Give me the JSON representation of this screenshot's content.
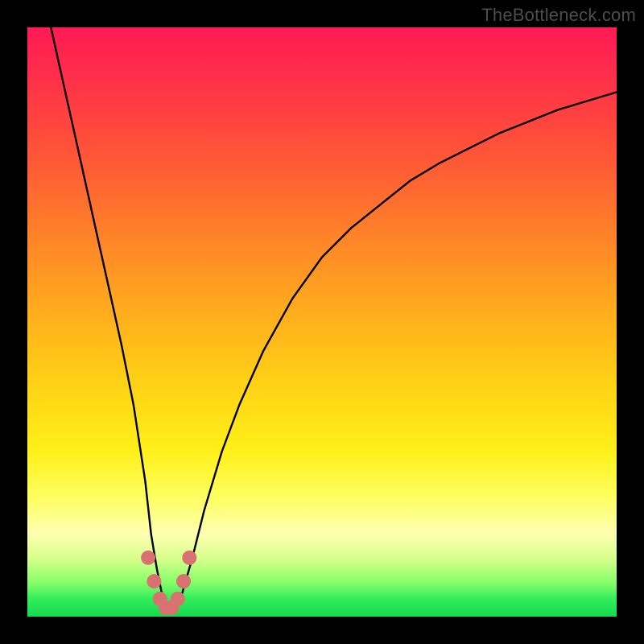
{
  "watermark": "TheBottleneck.com",
  "chart_data": {
    "type": "line",
    "title": "",
    "xlabel": "",
    "ylabel": "",
    "xlim": [
      0,
      100
    ],
    "ylim": [
      0,
      100
    ],
    "grid": false,
    "series": [
      {
        "name": "bottleneck-curve",
        "x": [
          4,
          6,
          8,
          10,
          12,
          14,
          16,
          18,
          20,
          21,
          22,
          23,
          24,
          25,
          26,
          28,
          30,
          33,
          36,
          40,
          45,
          50,
          55,
          60,
          65,
          70,
          75,
          80,
          85,
          90,
          95,
          100
        ],
        "values": [
          100,
          91,
          82,
          73,
          64,
          55,
          46,
          36,
          23,
          14,
          8,
          3,
          1,
          1,
          3,
          10,
          18,
          28,
          36,
          45,
          54,
          61,
          66,
          70,
          74,
          77,
          79.5,
          82,
          84,
          86,
          87.5,
          89
        ]
      },
      {
        "name": "highlight-dots",
        "x": [
          20.5,
          21.5,
          22.5,
          23.5,
          24.5,
          25.5,
          26.5,
          27.5
        ],
        "values": [
          10,
          6,
          3,
          1.5,
          1.5,
          3,
          6,
          10
        ]
      }
    ],
    "colors": {
      "curve": "#000000",
      "dots": "#d97171"
    }
  }
}
